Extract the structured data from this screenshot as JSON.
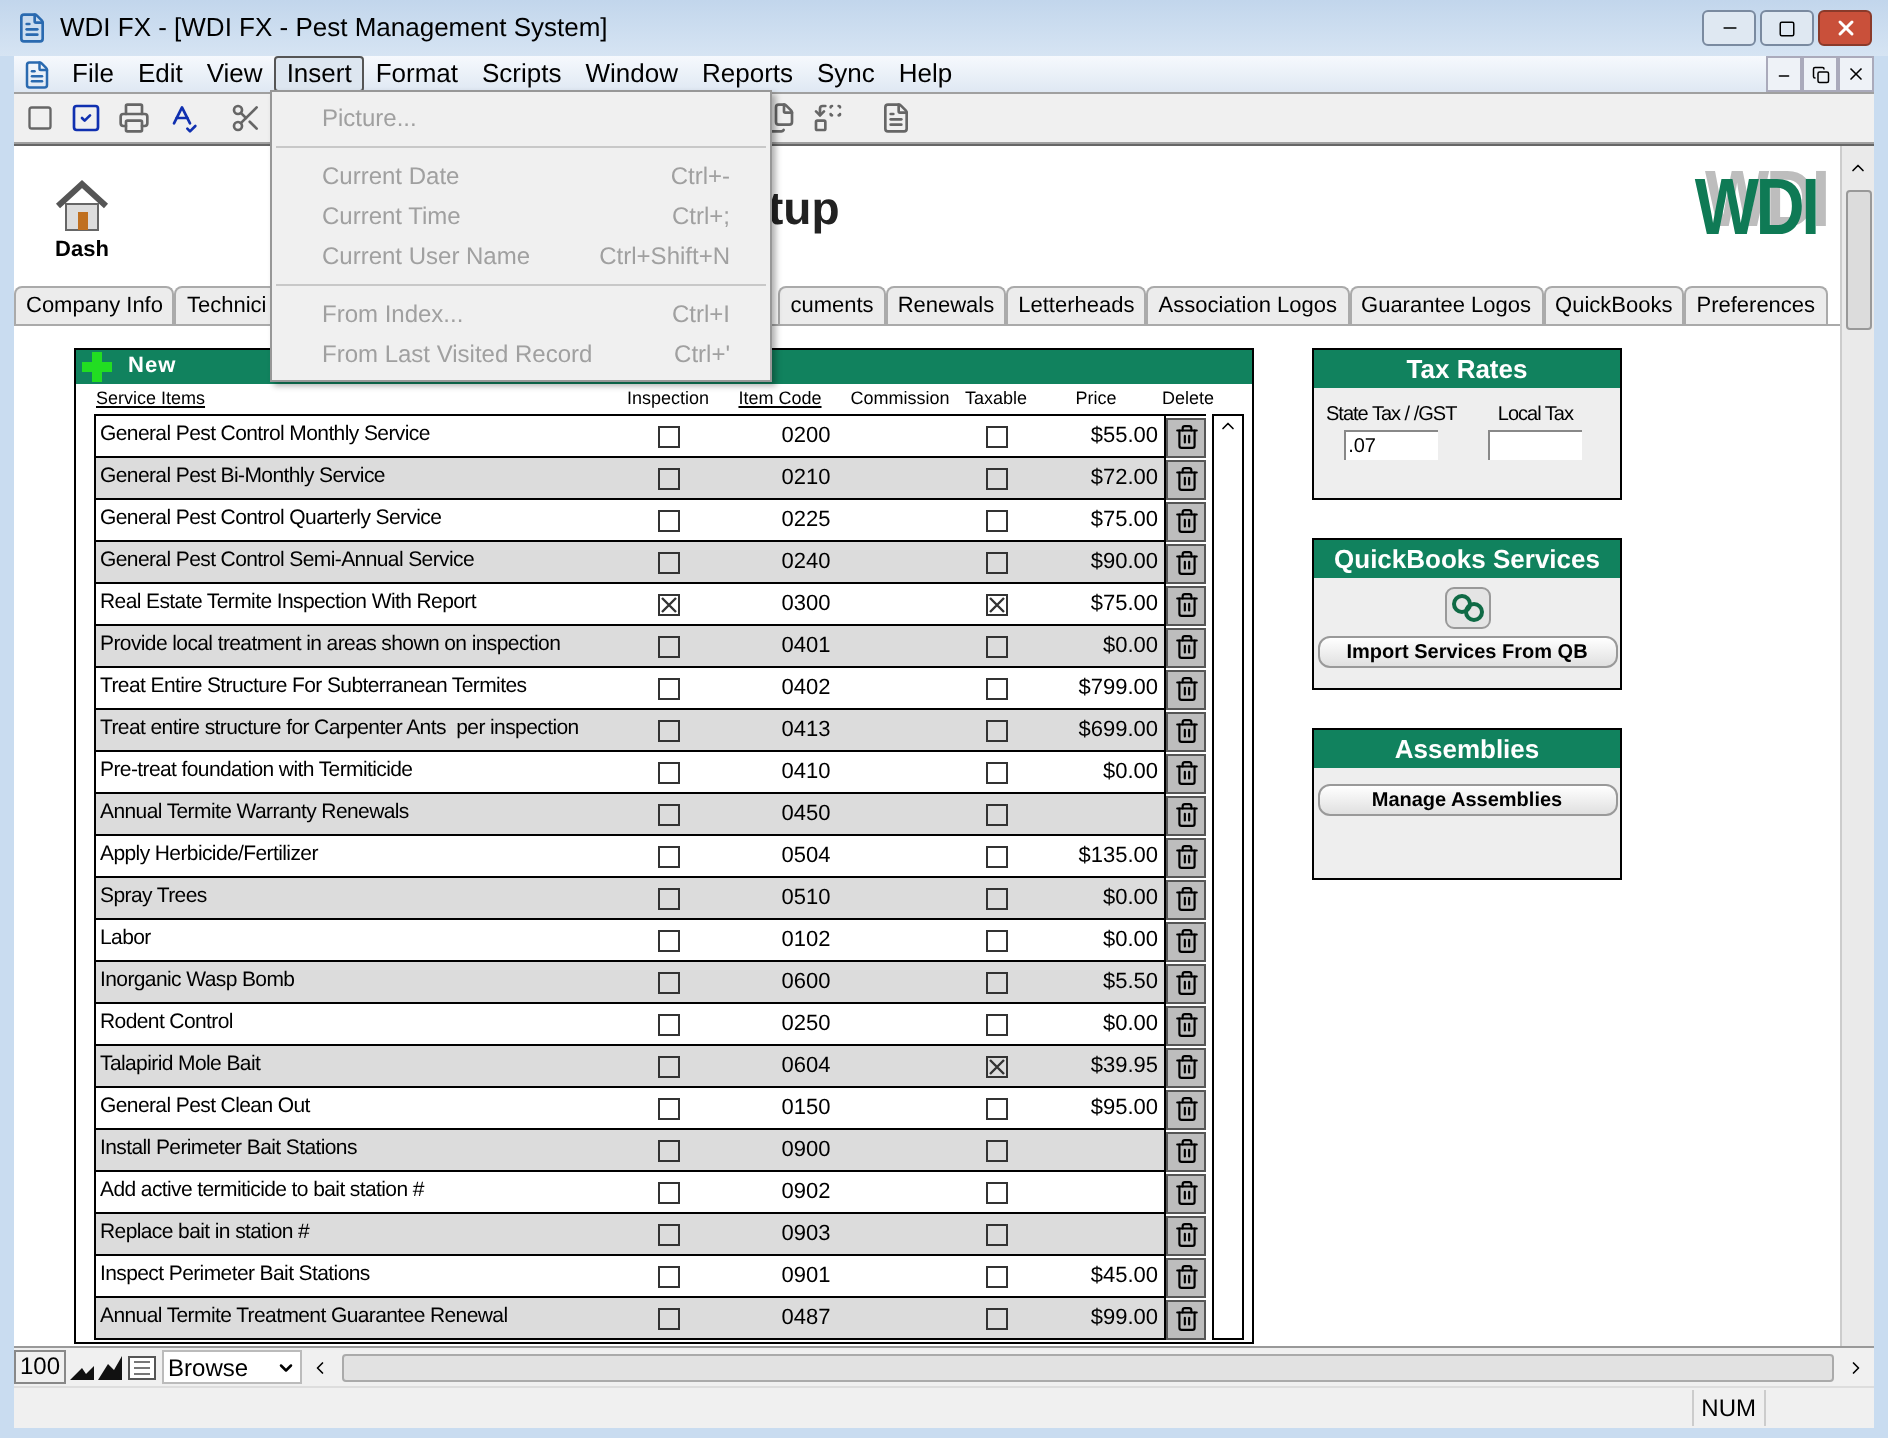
{
  "window": {
    "title": "WDI FX - [WDI FX - Pest Management System]"
  },
  "menu_bar": [
    {
      "label": "File",
      "selected": false
    },
    {
      "label": "Edit",
      "selected": false
    },
    {
      "label": "View",
      "selected": false
    },
    {
      "label": "Insert",
      "selected": true
    },
    {
      "label": "Format",
      "selected": false
    },
    {
      "label": "Scripts",
      "selected": false
    },
    {
      "label": "Window",
      "selected": false
    },
    {
      "label": "Reports",
      "selected": false
    },
    {
      "label": "Sync",
      "selected": false
    },
    {
      "label": "Help",
      "selected": false
    }
  ],
  "insert_menu": {
    "items": [
      {
        "kind": "item",
        "label": "Picture...",
        "disabled": true
      },
      {
        "kind": "separator"
      },
      {
        "kind": "item",
        "label": "Current Date",
        "shortcut": "Ctrl+-",
        "disabled": true
      },
      {
        "kind": "item",
        "label": "Current Time",
        "shortcut": "Ctrl+;",
        "disabled": true
      },
      {
        "kind": "item",
        "label": "Current User Name",
        "shortcut": "Ctrl+Shift+N",
        "disabled": true
      },
      {
        "kind": "separator"
      },
      {
        "kind": "item",
        "label": "From Index...",
        "shortcut": "Ctrl+I",
        "disabled": true
      },
      {
        "kind": "item",
        "label": "From Last Visited Record",
        "shortcut": "Ctrl+'",
        "disabled": true
      }
    ]
  },
  "header": {
    "home_label": "Dash",
    "title": "tup",
    "logo": "WDI"
  },
  "tabs": [
    {
      "label": "Company Info",
      "selected": false
    },
    {
      "label": "Technici",
      "selected": false
    },
    {
      "label": "cuments",
      "selected": false
    },
    {
      "label": "Renewals",
      "selected": false
    },
    {
      "label": "Letterheads",
      "selected": false
    },
    {
      "label": "Association Logos",
      "selected": false
    },
    {
      "label": "Guarantee Logos",
      "selected": false
    },
    {
      "label": "QuickBooks",
      "selected": false
    },
    {
      "label": "Preferences",
      "selected": false
    }
  ],
  "services": {
    "new_label": "New",
    "columns": [
      "Service Items",
      "Inspection",
      "Item Code",
      "Commission",
      "Taxable",
      "Price",
      "Delete"
    ],
    "rows": [
      {
        "name": "General Pest Control Monthly Service",
        "inspection": false,
        "code": "0200",
        "taxable": false,
        "price": "$55.00"
      },
      {
        "name": "General Pest Bi-Monthly Service",
        "inspection": false,
        "code": "0210",
        "taxable": false,
        "price": "$72.00"
      },
      {
        "name": "General Pest Control Quarterly Service",
        "inspection": false,
        "code": "0225",
        "taxable": false,
        "price": "$75.00"
      },
      {
        "name": "General Pest Control Semi-Annual Service",
        "inspection": false,
        "code": "0240",
        "taxable": false,
        "price": "$90.00"
      },
      {
        "name": "Real Estate Termite Inspection With Report",
        "inspection": true,
        "code": "0300",
        "taxable": true,
        "price": "$75.00"
      },
      {
        "name": "Provide local treatment in areas shown on inspection",
        "inspection": false,
        "code": "0401",
        "taxable": false,
        "price": "$0.00"
      },
      {
        "name": "Treat Entire Structure For Subterranean Termites",
        "inspection": false,
        "code": "0402",
        "taxable": false,
        "price": "$799.00"
      },
      {
        "name": "Treat entire structure for Carpenter Ants  per inspection",
        "inspection": false,
        "code": "0413",
        "taxable": false,
        "price": "$699.00"
      },
      {
        "name": "Pre-treat foundation with Termiticide",
        "inspection": false,
        "code": "0410",
        "taxable": false,
        "price": "$0.00"
      },
      {
        "name": "Annual Termite Warranty Renewals",
        "inspection": false,
        "code": "0450",
        "taxable": false
      },
      {
        "name": "Apply Herbicide/Fertilizer",
        "inspection": false,
        "code": "0504",
        "taxable": false,
        "price": "$135.00"
      },
      {
        "name": "Spray Trees",
        "inspection": false,
        "code": "0510",
        "taxable": false,
        "price": "$0.00"
      },
      {
        "name": "Labor",
        "inspection": false,
        "code": "0102",
        "taxable": false,
        "price": "$0.00"
      },
      {
        "name": "Inorganic Wasp Bomb",
        "inspection": false,
        "code": "0600",
        "taxable": false,
        "price": "$5.50"
      },
      {
        "name": "Rodent Control",
        "inspection": false,
        "code": "0250",
        "taxable": false,
        "price": "$0.00"
      },
      {
        "name": "Talapirid Mole Bait",
        "inspection": false,
        "code": "0604",
        "taxable": true,
        "price": "$39.95"
      },
      {
        "name": "General Pest Clean Out",
        "inspection": false,
        "code": "0150",
        "taxable": false,
        "price": "$95.00"
      },
      {
        "name": "Install Perimeter Bait Stations",
        "inspection": false,
        "code": "0900",
        "taxable": false
      },
      {
        "name": "Add active termiticide to bait station #",
        "inspection": false,
        "code": "0902",
        "taxable": false
      },
      {
        "name": "Replace bait in station #",
        "inspection": false,
        "code": "0903",
        "taxable": false
      },
      {
        "name": "Inspect Perimeter Bait Stations",
        "inspection": false,
        "code": "0901",
        "taxable": false,
        "price": "$45.00"
      },
      {
        "name": "Annual Termite Treatment Guarantee Renewal",
        "inspection": false,
        "code": "0487",
        "taxable": false,
        "price": "$99.00"
      }
    ]
  },
  "tax_rates": {
    "title": "Tax Rates",
    "state_label": "State Tax / /GST",
    "state_value": ".07",
    "local_label": "Local Tax"
  },
  "quickbooks": {
    "title": "QuickBooks Services",
    "button": "Import Services From QB"
  },
  "assemblies": {
    "title": "Assemblies",
    "button": "Manage Assemblies"
  },
  "bottom_bar": {
    "zoom": "100",
    "mode": "Browse"
  },
  "status_bar": {
    "indicator": "NUM"
  }
}
